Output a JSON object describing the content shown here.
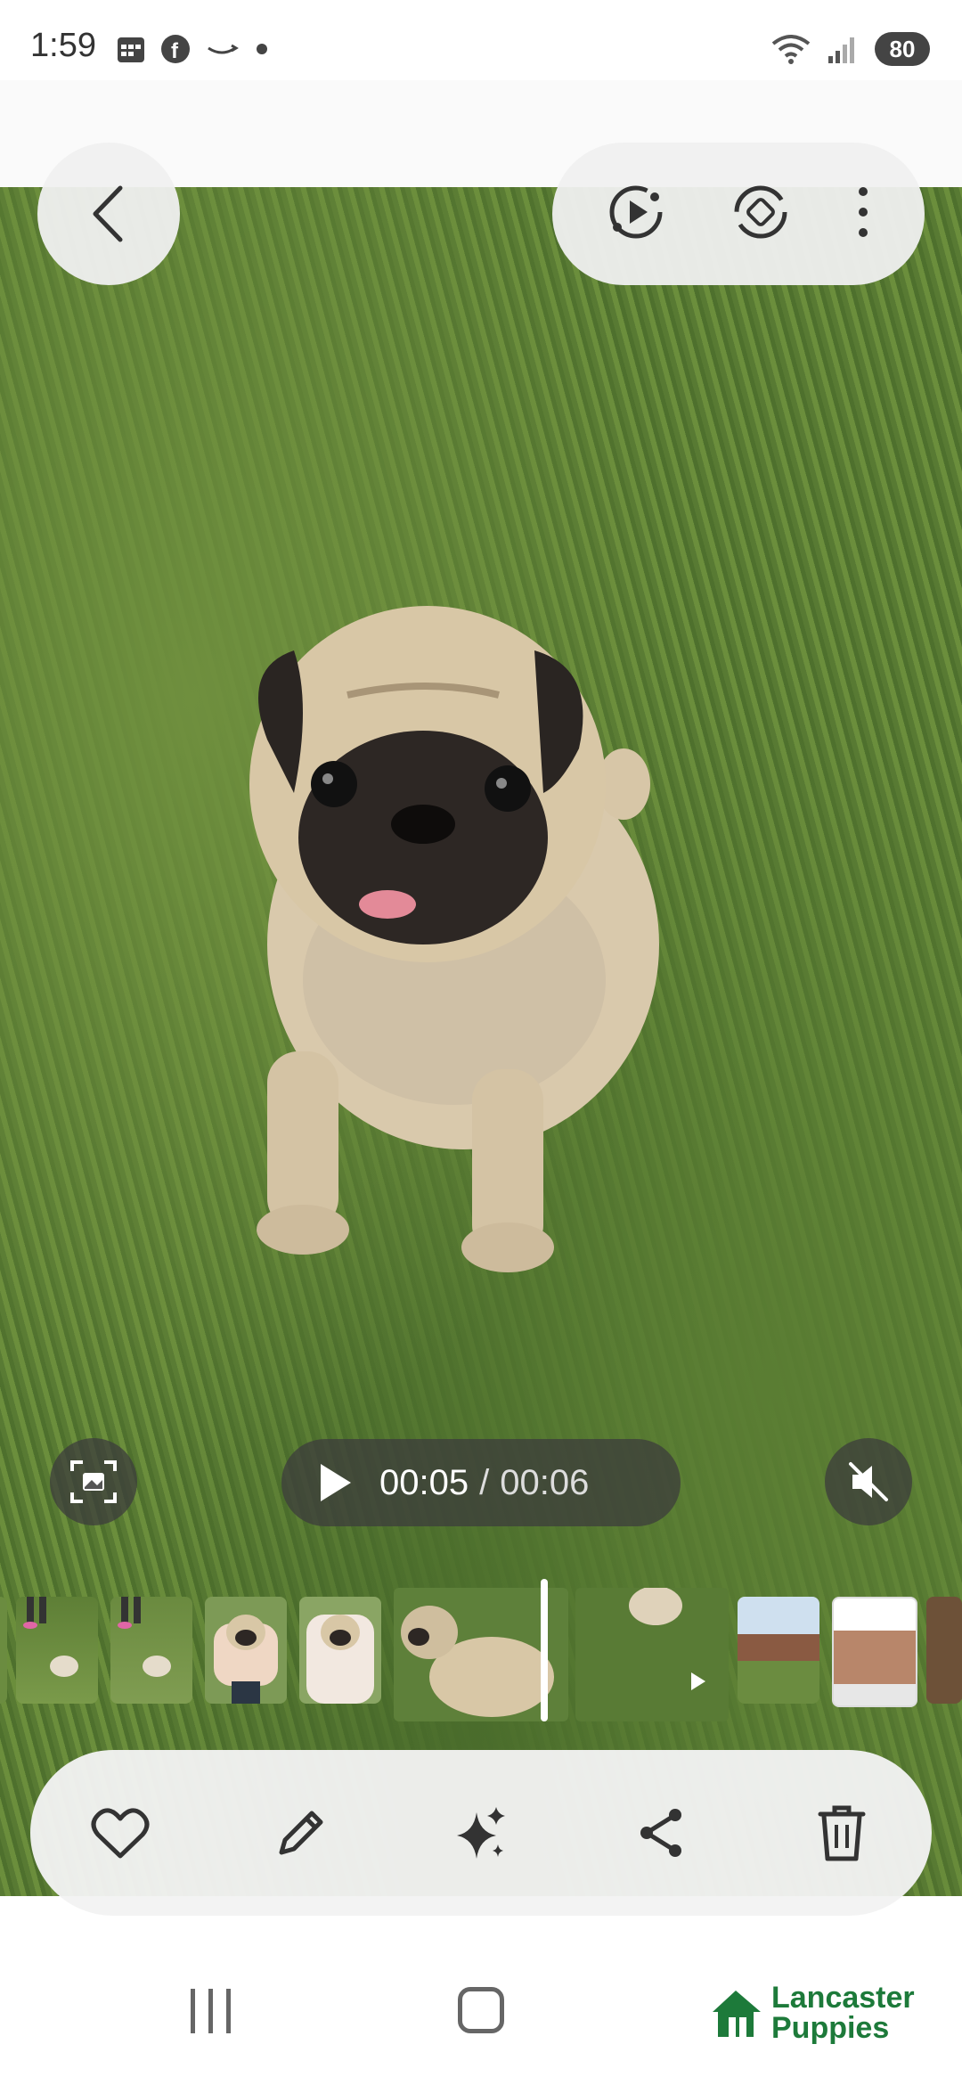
{
  "status_bar": {
    "time": "1:59",
    "battery": "80",
    "left_icons": [
      "calendar-icon",
      "facebook-icon",
      "amazon-icon",
      "dot-icon"
    ],
    "right_icons": [
      "wifi-icon",
      "signal-icon",
      "battery-icon"
    ]
  },
  "viewer": {
    "top_actions": [
      "back-icon",
      "play-motion-icon",
      "rotate-icon",
      "more-icon"
    ]
  },
  "video": {
    "current_time": "00:05",
    "separator": "/",
    "total_time": "00:06",
    "progress_fraction": 0.83
  },
  "toolbar": {
    "items": [
      "heart-icon",
      "pencil-icon",
      "sparkle-icon",
      "share-icon",
      "trash-icon"
    ]
  },
  "nav": {
    "logo_line1": "Lancaster",
    "logo_line2": "Puppies"
  },
  "colors": {
    "logo_green": "#1d7a3a",
    "overlay_dark": "#3c3c3c",
    "pill_light": "#f0f0f0"
  }
}
